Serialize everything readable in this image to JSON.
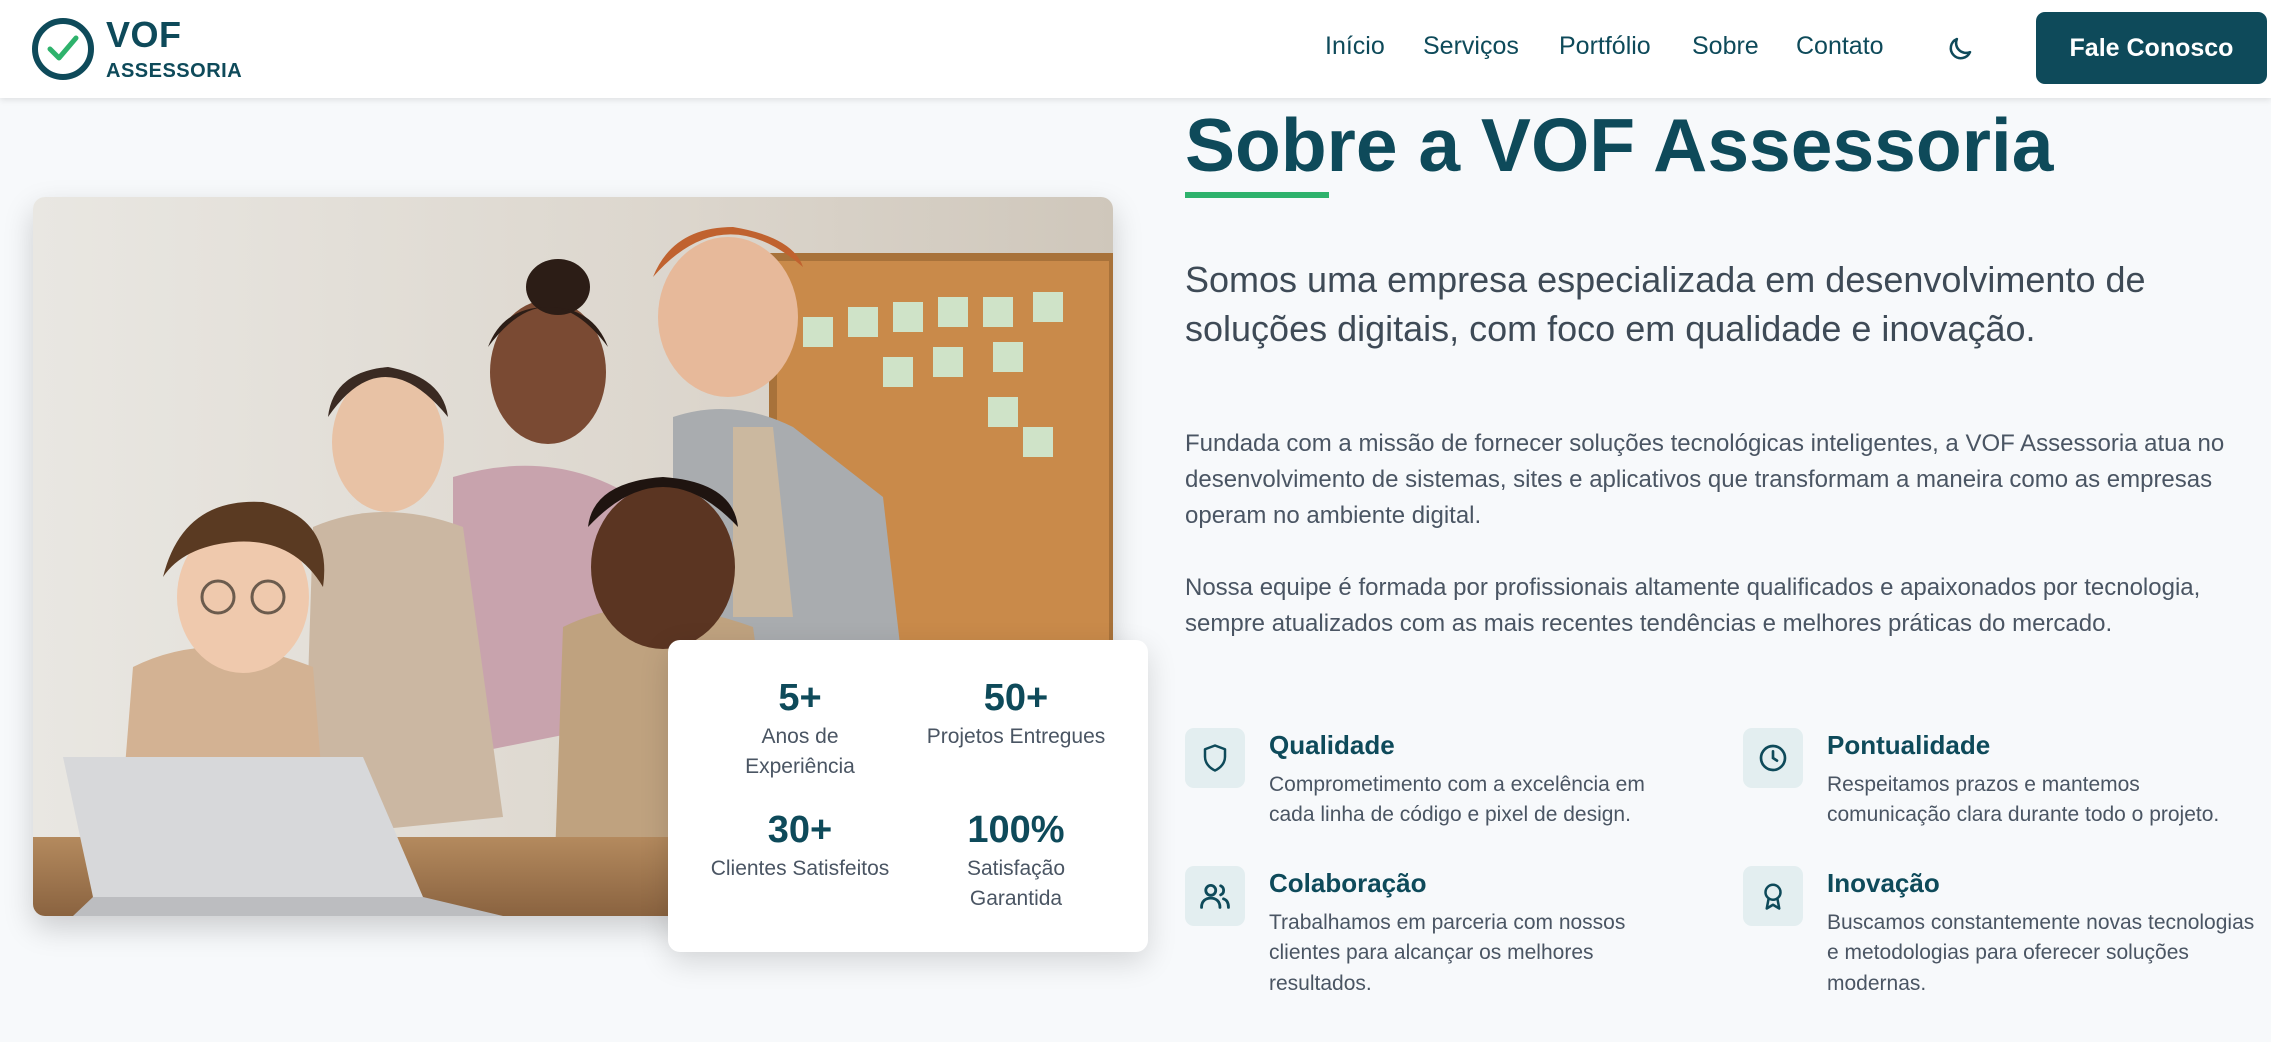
{
  "brand": {
    "name": "VOF",
    "sub": "ASSESSORIA",
    "color_primary": "#0e4a5a",
    "color_accent": "#2eb26c"
  },
  "nav": {
    "items": [
      "Início",
      "Serviços",
      "Portfólio",
      "Sobre",
      "Contato"
    ],
    "theme_icon": "moon-icon",
    "cta_label": "Fale Conosco"
  },
  "about": {
    "title": "Sobre a VOF Assessoria",
    "lead": "Somos uma empresa especializada em desenvolvimento de soluções digitais, com foco em qualidade e inovação.",
    "paragraph_1": "Fundada com a missão de fornecer soluções tecnológicas inteligentes, a VOF Assessoria atua no desenvolvimento de sistemas, sites e aplicativos que transformam a maneira como as empresas operam no ambiente digital.",
    "paragraph_2": "Nossa equipe é formada por profissionais altamente qualificados e apaixonados por tecnologia, sempre atualizados com as mais recentes tendências e melhores práticas do mercado."
  },
  "stats": [
    {
      "value": "5+",
      "label": "Anos de Experiência"
    },
    {
      "value": "50+",
      "label": "Projetos Entregues"
    },
    {
      "value": "30+",
      "label": "Clientes Satisfeitos"
    },
    {
      "value": "100%",
      "label": "Satisfação Garantida"
    }
  ],
  "features": [
    {
      "icon": "shield-icon",
      "title": "Qualidade",
      "desc": "Comprometimento com a excelência em cada linha de código e pixel de design."
    },
    {
      "icon": "clock-icon",
      "title": "Pontualidade",
      "desc": "Respeitamos prazos e mantemos comunicação clara durante todo o projeto."
    },
    {
      "icon": "users-icon",
      "title": "Colaboração",
      "desc": "Trabalhamos em parceria com nossos clientes para alcançar os melhores resultados."
    },
    {
      "icon": "award-icon",
      "title": "Inovação",
      "desc": "Buscamos constantemente novas tecnologias e metodologias para oferecer soluções modernas."
    }
  ]
}
